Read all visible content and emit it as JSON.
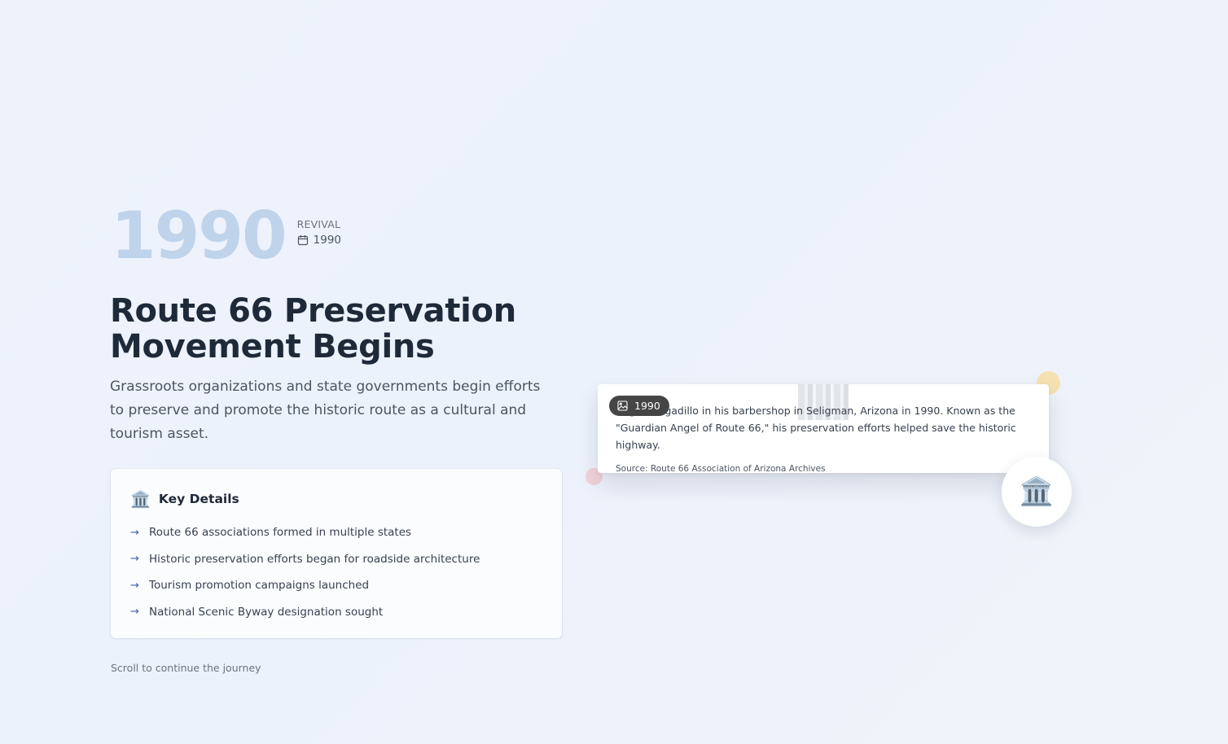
{
  "header": {
    "big_year": "1990",
    "era": "REVIVAL",
    "date": "1990",
    "date_icon": "calendar-icon"
  },
  "main": {
    "title": "Route 66 Preservation Movement Begins",
    "description": "Grassroots organizations and state governments begin efforts to preserve and promote the historic route as a cultural and tourism asset."
  },
  "details": {
    "icon": "🏛️",
    "heading": "Key Details",
    "items": [
      {
        "label": "Route 66 associations formed in multiple states"
      },
      {
        "label": "Historic preservation efforts began for roadside architecture"
      },
      {
        "label": "Tourism promotion campaigns launched"
      },
      {
        "label": "National Scenic Byway designation sought"
      }
    ]
  },
  "footer": {
    "scroll_hint": "Scroll to continue the journey"
  },
  "media": {
    "badge_year": "1990",
    "badge_icon": "image-icon",
    "caption": "Angel Delgadillo in his barbershop in Seligman, Arizona in 1990. Known as the \"Guardian Angel of Route 66,\" his preservation efforts helped save the historic highway.",
    "source": "Source: Route 66 Association of Arizona Archives",
    "external_icon": "external-link-icon",
    "category_icon": "🏛️"
  },
  "colors": {
    "big_year": "#bfd3eb",
    "title": "#1e2939",
    "accent_arrow": "#3b5bb5",
    "badge_bg": "#454545",
    "dot_yellow": "#f6e1b1",
    "dot_pink": "#f1d2d9"
  }
}
